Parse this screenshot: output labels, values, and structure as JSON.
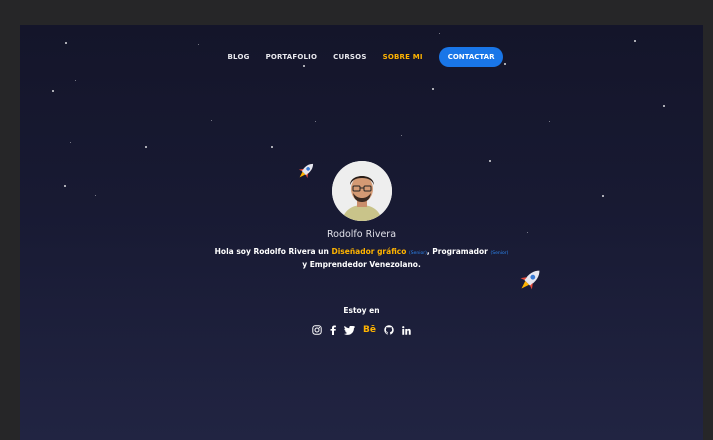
{
  "nav": {
    "items": [
      {
        "label": "BLOG"
      },
      {
        "label": "PORTAFOLIO"
      },
      {
        "label": "CURSOS"
      },
      {
        "label": "SOBRE MI"
      }
    ],
    "contact_label": "CONTACTAR"
  },
  "profile": {
    "name": "Rodolfo Rivera",
    "bio_line1_pre": "Hola soy Rodolfo Rivera un ",
    "bio_role1": "Diseñador gráfico",
    "bio_tag1": "(Senior)",
    "bio_mid": ", Programador ",
    "bio_tag2": "(Senior)",
    "bio_line2": "y Emprendedor Venezolano."
  },
  "social": {
    "title": "Estoy en",
    "behance_label": "Bē",
    "icons": [
      "instagram-icon",
      "facebook-icon",
      "twitter-icon",
      "behance-icon",
      "github-icon",
      "linkedin-icon"
    ]
  },
  "colors": {
    "accent": "#ffb400",
    "button": "#1976e8",
    "background_top": "#14152a",
    "background_bottom": "#212442"
  }
}
